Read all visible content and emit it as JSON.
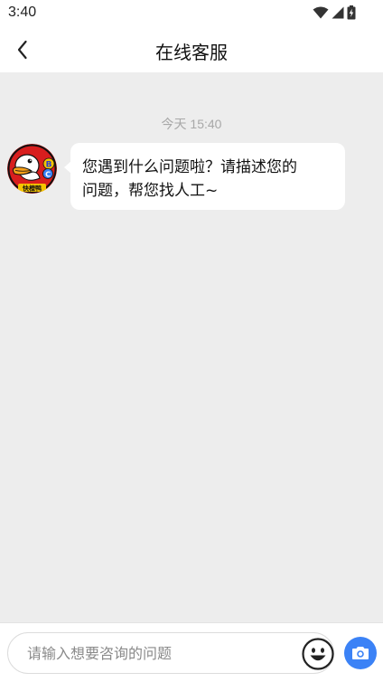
{
  "status_bar": {
    "time": "3:40",
    "icons": [
      "wifi-icon",
      "cell-signal-icon",
      "battery-charging-icon"
    ]
  },
  "header": {
    "title": "在线客服",
    "back_icon": "chevron-left-icon"
  },
  "chat": {
    "timestamp": "今天 15:40",
    "messages": [
      {
        "sender": "agent",
        "avatar_text": "快橙鸭",
        "avatar_letters": [
          "B",
          "C"
        ],
        "lines": [
          "您遇到什么问题啦？请描述您的",
          "问题，帮您找人工~"
        ]
      }
    ]
  },
  "composer": {
    "placeholder": "请输入想要咨询的问题",
    "emoji_icon": "emoji-icon",
    "camera_icon": "camera-icon"
  },
  "colors": {
    "background": "#ededed",
    "bubble": "#ffffff",
    "accent": "#3b82f6",
    "avatar_bg": "#d81e1e"
  }
}
